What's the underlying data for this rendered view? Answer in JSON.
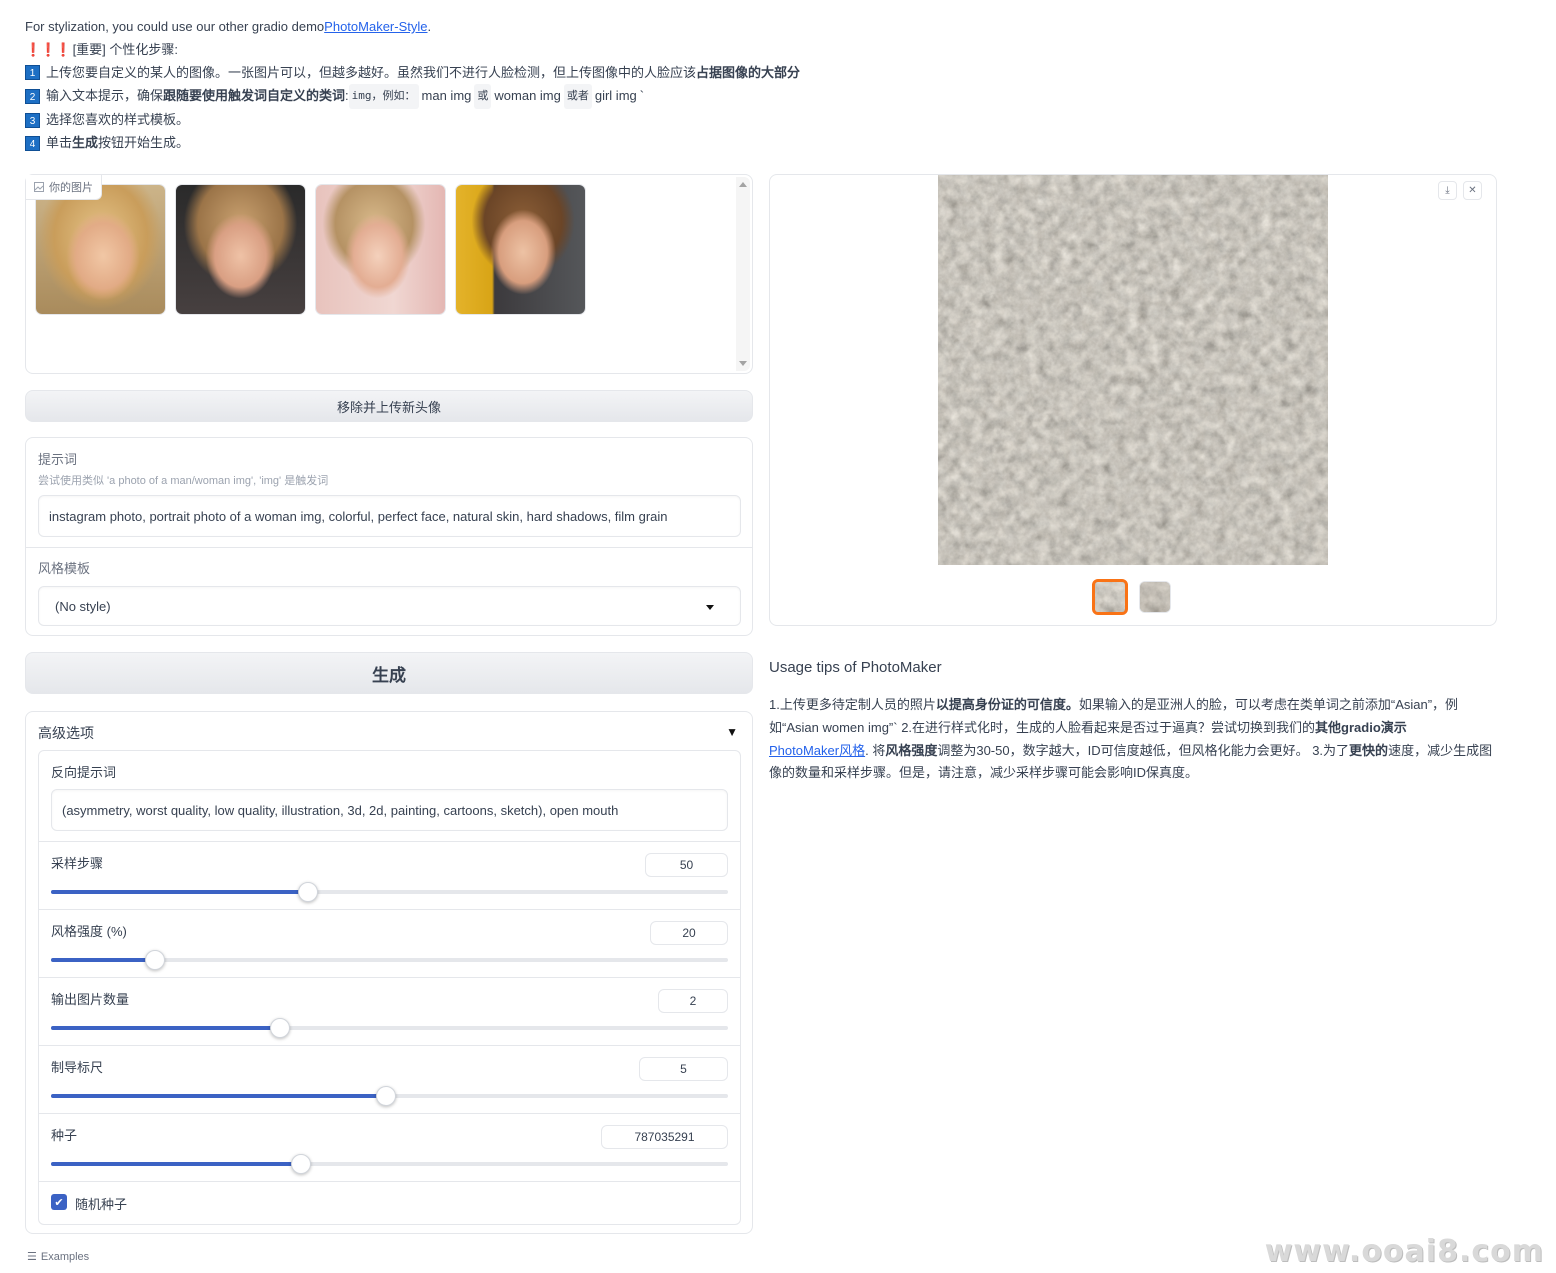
{
  "intro": {
    "stylization_prefix": "For stylization, you could use our other gradio demo ",
    "stylization_link": "PhotoMaker-Style",
    "stylization_suffix": ".",
    "important_marks": "❗❗❗",
    "important": "[重要] 个性化步骤:",
    "step1_num": "1",
    "step1_text": "上传您要自定义的某人的图像。一张图片可以，但越多越好。虽然我们不进行人脸检测，但上传图像中的人脸应该",
    "step1_bold": "占据图像的大部分",
    "step2_num": "2",
    "step2_text": "输入文本提示，确保",
    "step2_bold": "跟随要使用触发词自定义的类词",
    "step2_colon": ":",
    "step2_code1": "img，例如：",
    "step2_man": "man img",
    "step2_or1": "或",
    "step2_woman": "woman img",
    "step2_or2": "或者",
    "step2_girl": "girl img",
    "step2_tick": "`",
    "step3_num": "3",
    "step3_text": "选择您喜欢的样式模板。",
    "step4_num": "4",
    "step4_pre": "单击",
    "step4_bold": "生成",
    "step4_post": "按钮开始生成。"
  },
  "upload_gallery": {
    "label": "你的图片",
    "image_count": 4
  },
  "remove_button": "移除并上传新头像",
  "prompt": {
    "label": "提示词",
    "info": "尝试使用类似 'a photo of a man/woman img', 'img' 是触发词",
    "value": "instagram photo, portrait photo of a woman img, colorful, perfect face, natural skin, hard shadows, film grain"
  },
  "style": {
    "label": "风格模板",
    "value": "(No style)"
  },
  "generate_button": "生成",
  "advanced": {
    "title": "高级选项",
    "toggle": "▼",
    "negative_label": "反向提示词",
    "negative_value": "(asymmetry, worst quality, low quality, illustration, 3d, 2d, painting, cartoons, sketch), open mouth",
    "sliders": [
      {
        "label": "采样步骤",
        "value": "50",
        "fraction": 0.38
      },
      {
        "label": "风格强度 (%)",
        "value": "20",
        "fraction": 0.153
      },
      {
        "label": "输出图片数量",
        "value": "2",
        "fraction": 0.338
      },
      {
        "label": "制导标尺",
        "value": "5",
        "fraction": 0.495
      },
      {
        "label": "种子",
        "value": "787035291",
        "fraction": 0.369
      }
    ],
    "random_seed_label": "随机种子",
    "random_seed_checked": true
  },
  "examples_label": "Examples",
  "output_gallery": {
    "selected_index": 0,
    "image_count": 2
  },
  "tips": {
    "title": "Usage tips of PhotoMaker",
    "p1": "1.上传更多待定制人员的照片",
    "p1b": "以提高身份证的可信度。",
    "p2": "如果输入的是亚洲人的脸，可以考虑在类单词之前添加“Asian”，例如“Asian women img”` 2.在进行样式化时，生成的人脸看起来是否过于逼真？尝试切换到我们的",
    "p2b": "其他gradio演示",
    "link": "PhotoMaker风格",
    "p3": ". 将",
    "p3b": "风格强度",
    "p4": "调整为30-50，数字越大，ID可信度越低，但风格化能力会更好。 3.为了",
    "p4b": "更快的",
    "p5": "速度，减少生成图像的数量和采样步骤。但是，请注意，减少采样步骤可能会影响ID保真度。"
  },
  "watermark": "www.ooai8.com",
  "colors": {
    "accent": "#3b62c4",
    "selected_border": "#f97316",
    "step_badge": "#1d6fc4"
  }
}
